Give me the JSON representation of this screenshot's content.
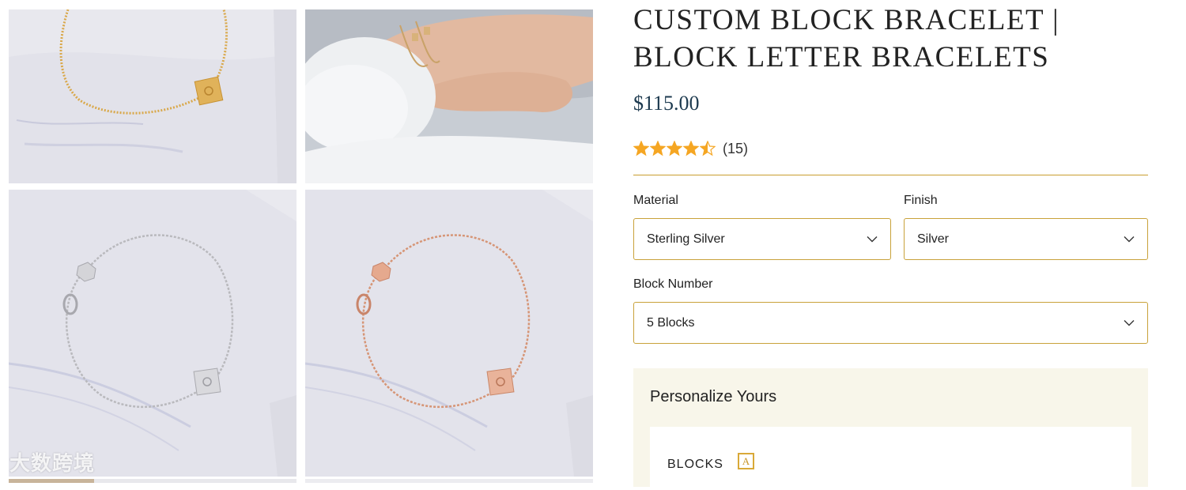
{
  "product": {
    "title": "CUSTOM BLOCK BRACELET | BLOCK LETTER BRACELETS",
    "price": "$115.00",
    "rating": 4.5,
    "rating_max": 5,
    "review_count": "(15)",
    "star_color": "#f5a623"
  },
  "options": {
    "material": {
      "label": "Material",
      "value": "Sterling Silver"
    },
    "finish": {
      "label": "Finish",
      "value": "Silver"
    },
    "block_number": {
      "label": "Block Number",
      "value": "5 Blocks"
    }
  },
  "personalize": {
    "title": "Personalize Yours",
    "blocks_label": "BLOCKS",
    "block_letter": "A"
  },
  "gallery": {
    "images": [
      {
        "name": "gold-bracelet-photo",
        "metal_color": "#d9a84a"
      },
      {
        "name": "wrist-bracelet-photo",
        "metal_color": "#c9a268"
      },
      {
        "name": "silver-bracelet-photo",
        "metal_color": "#b9b9bd"
      },
      {
        "name": "rose-gold-bracelet-photo",
        "metal_color": "#d69576"
      }
    ]
  },
  "watermark": "大数跨境",
  "colors": {
    "accent": "#c9a23a",
    "price": "#1d3a4f",
    "panel_bg": "#f8f6ea"
  }
}
